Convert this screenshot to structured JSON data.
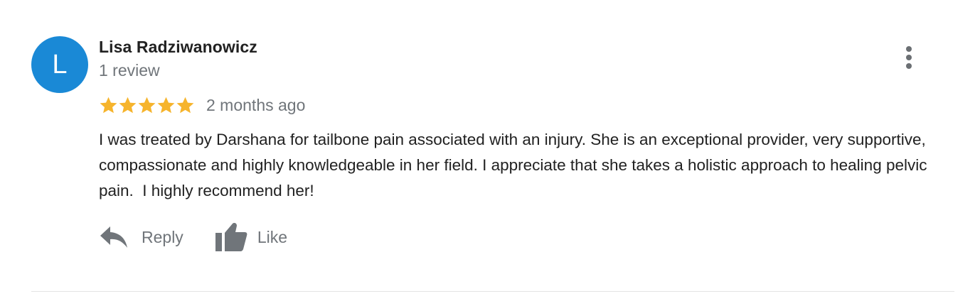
{
  "review": {
    "avatar_letter": "L",
    "avatar_color": "#1a89d6",
    "reviewer_name": "Lisa Radziwanowicz",
    "review_count": "1 review",
    "rating": 5,
    "rating_max": 5,
    "star_color": "#f6b42c",
    "date": "2 months ago",
    "text": "I was treated by Darshana for tailbone pain associated with an injury. She is an exceptional provider, very supportive, compassionate and highly knowledgeable in her field. I appreciate that she takes a holistic approach to healing pelvic pain.  I highly recommend her!",
    "more_icon": "more-vertical-icon"
  },
  "actions": {
    "reply": {
      "label": "Reply",
      "icon": "reply-icon"
    },
    "like": {
      "label": "Like",
      "icon": "thumbs-up-icon"
    }
  }
}
